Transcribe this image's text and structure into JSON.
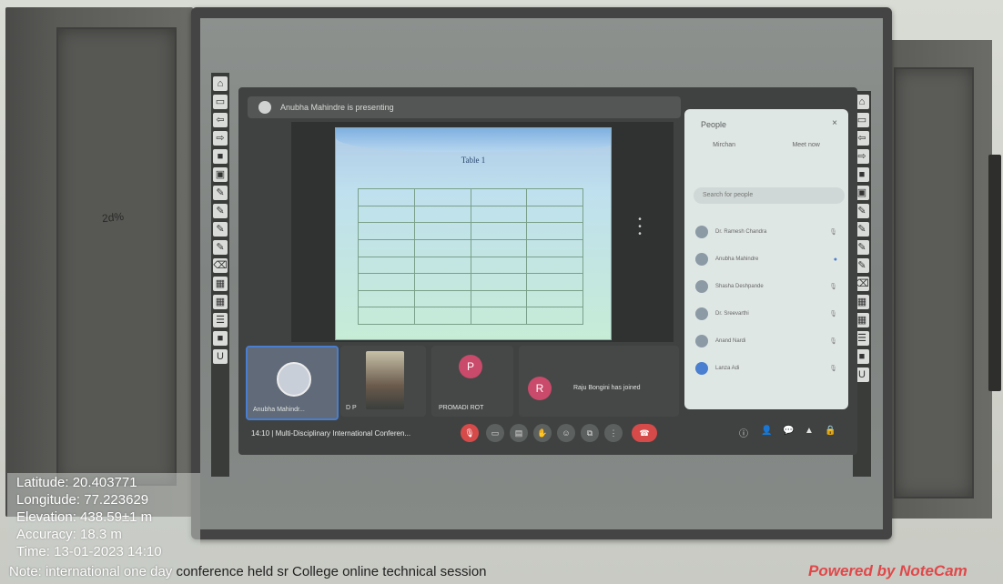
{
  "meet": {
    "presenter_text": "Anubha Mahindre is presenting",
    "clock": "14:10",
    "meeting_title": "Multi-Disciplinary International Conferen...",
    "slide": {
      "title": "Table 1"
    },
    "tiles": [
      {
        "label": "Anubha Mahindr...",
        "kind": "avatar"
      },
      {
        "label": "D P",
        "kind": "video"
      },
      {
        "label": "PROMADI ROT",
        "initial": "P",
        "kind": "initial",
        "color": "#c94a6a"
      },
      {
        "label": "Raju Bongini has joined",
        "initial": "R",
        "kind": "initial",
        "color": "#c94a6a"
      }
    ],
    "people_panel": {
      "title": "People",
      "close": "×",
      "tabs": [
        "Mirchan",
        "Meet now"
      ],
      "search_placeholder": "Search for people",
      "rows": [
        {
          "name": "Dr. Ramesh Chandra"
        },
        {
          "name": "Anubha Mahindre"
        },
        {
          "name": "Shasha Deshpande"
        },
        {
          "name": "Dr. Sreevarthi"
        },
        {
          "name": "Anand Nardi"
        },
        {
          "name": "Lanza Adi"
        }
      ]
    }
  },
  "overlay": {
    "latitude": "Latitude: 20.403771",
    "longitude": "Longitude: 77.223629",
    "elevation": "Elevation: 438.59±1 m",
    "accuracy": "Accuracy: 18.3 m",
    "time": "Time: 13-01-2023 14:10",
    "note_prefix": "Note: international one day",
    "note_suffix": "conference held sr College online technical session",
    "powered": "Powered by NoteCam"
  },
  "scribble": "2d%"
}
